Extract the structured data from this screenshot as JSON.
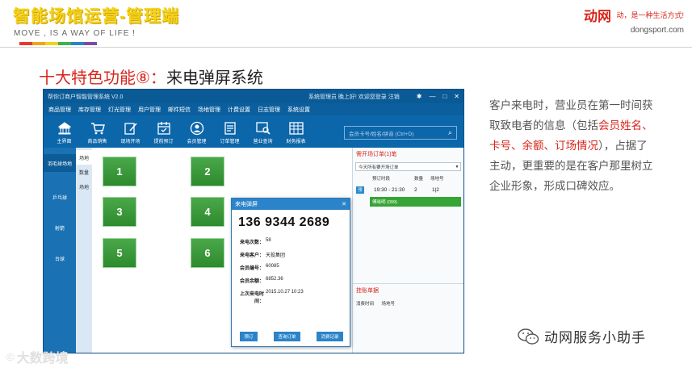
{
  "header": {
    "title": "智能场馆运营-管理端",
    "subtitle": "MOVE , IS A WAY OF LIFE !",
    "colorbar": [
      "#e53b2c",
      "#f2a31a",
      "#f5d21a",
      "#3db34a",
      "#2b84c9",
      "#7d4aa0"
    ],
    "logo": {
      "brand": "动网",
      "slogan": "动，是一种生活方式!",
      "url": "dongsport.com"
    }
  },
  "feature": {
    "prefix": "十大特色功能⑧：",
    "name": "来电弹屏系统"
  },
  "app": {
    "window_title": "帮你订商户智能管理系统 V2.0",
    "user_info": "系统管理员 晚上好! 欢迎您登录  注销",
    "menu": [
      "商品管理",
      "库存管理",
      "灯光管理",
      "用户管理",
      "邮件短信",
      "场地管理",
      "计费设置",
      "日志管理",
      "系统设置"
    ],
    "toolbar": [
      {
        "label": "主界面",
        "icon": "home-icon"
      },
      {
        "label": "商品销售",
        "icon": "cart-icon"
      },
      {
        "label": "现场开场",
        "icon": "edit-icon"
      },
      {
        "label": "提前预订",
        "icon": "calendar-icon"
      },
      {
        "label": "会员管理",
        "icon": "user-icon"
      },
      {
        "label": "订单管理",
        "icon": "order-icon"
      },
      {
        "label": "营业查询",
        "icon": "query-icon"
      },
      {
        "label": "财务报表",
        "icon": "report-icon"
      }
    ],
    "search_placeholder": "会员卡号/姓名/拼音  (Ctrl+D)",
    "left_nav": [
      "羽毛球场地",
      "乒乓球",
      "射箭",
      "台球"
    ],
    "sub_nav": [
      "场地",
      "数量",
      "场地"
    ],
    "courts": [
      "1",
      "2",
      "3",
      "4",
      "5",
      "6"
    ],
    "right_panel": {
      "section1_title": "需开场订单(1)笔",
      "filter": "今天所有要开场订单",
      "columns": [
        "预订时段",
        "数量",
        "场地号"
      ],
      "order": {
        "tag": "预",
        "time": "19:30 - 21:30",
        "qty": "2",
        "court": "1|2"
      },
      "member": "傅晓明 (099)",
      "section2_title": "挂账单据",
      "section2_cols": [
        "消费时间",
        "场地号"
      ]
    },
    "popup": {
      "title": "来电弹屏",
      "phone": "136 9344 2689",
      "fields": [
        {
          "label": "来电次数：",
          "value": "58"
        },
        {
          "label": "来电客户：",
          "value": "天投集团"
        },
        {
          "label": "会员编号：",
          "value": "60085"
        },
        {
          "label": "会员余额：",
          "value": "6852.36"
        },
        {
          "label": "上次来电时间：",
          "value": "2015.10.27 10:23"
        }
      ],
      "buttons": [
        "预订",
        "查询订单",
        "消费记录"
      ]
    }
  },
  "description": {
    "p1": "客户来电时，营业员在第一时间获取致电者的信息（包括",
    "h1": "会员姓名、卡号、余额、订场情况",
    "p2": "），占据了主动，更重要的是在客户那里树立企业形象，形成口碑效应。"
  },
  "watermarks": {
    "wechat": "动网服务小助手",
    "dsj": "大数跨境"
  }
}
